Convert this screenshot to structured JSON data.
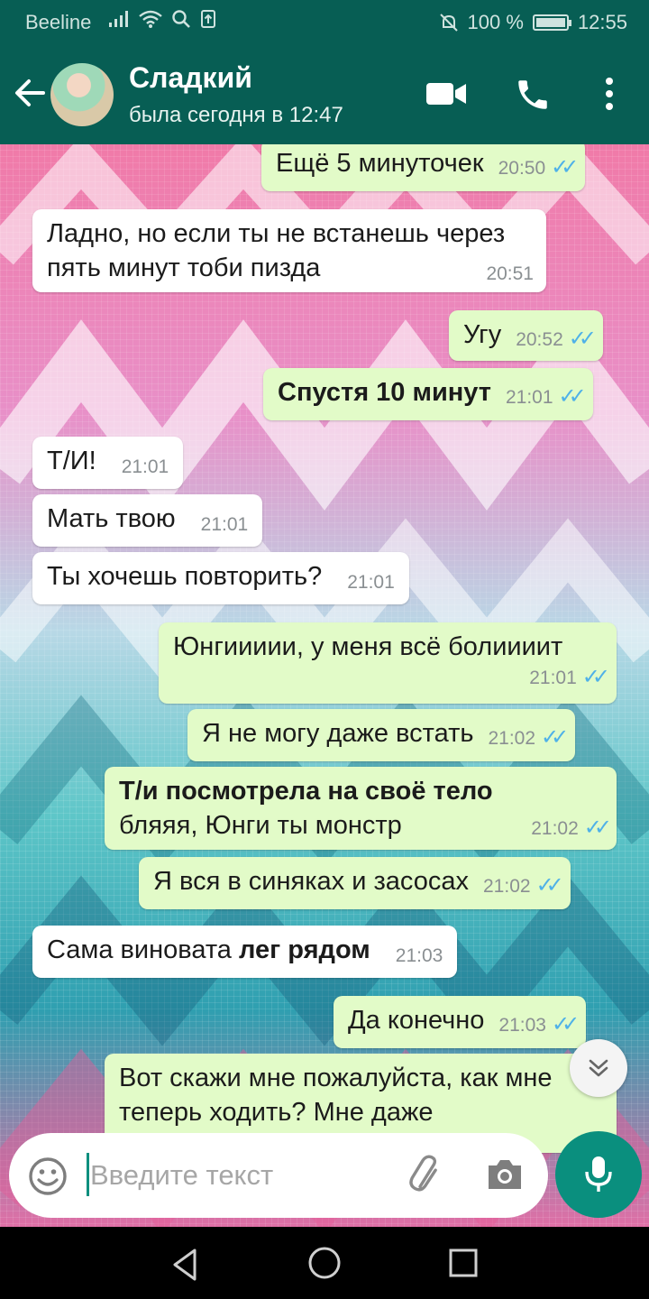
{
  "status_bar": {
    "carrier": "Beeline",
    "battery": "100 %",
    "battery_level": 1.0,
    "time": "12:55"
  },
  "header": {
    "contact_name": "Сладкий",
    "last_seen": "была сегодня в 12:47"
  },
  "messages": [
    {
      "dir": "out",
      "text": "Ещё 5 минуточек",
      "time": "20:50",
      "ticks": "✓✓"
    },
    {
      "dir": "in",
      "text": "Ладно, но если ты не встанешь через пять минут тоби пизда",
      "time": "20:51"
    },
    {
      "dir": "out",
      "text": "Угу",
      "time": "20:52",
      "ticks": "✓✓"
    },
    {
      "dir": "out",
      "text": "Спустя 10 минут",
      "time": "21:01",
      "ticks": "✓✓",
      "bold": true
    },
    {
      "dir": "in",
      "text": "Т/И!",
      "time": "21:01"
    },
    {
      "dir": "in",
      "text": "Мать твою",
      "time": "21:01"
    },
    {
      "dir": "in",
      "text": "Ты хочешь повторить?",
      "time": "21:01"
    },
    {
      "dir": "out",
      "text": "Юнгиииии, у меня всё болиииит",
      "time": "21:01",
      "ticks": "✓✓"
    },
    {
      "dir": "out",
      "text": "Я не могу даже встать",
      "time": "21:02",
      "ticks": "✓✓"
    },
    {
      "dir": "out",
      "text_bold": "Т/и посмотрела на своё тело",
      "text": "бляяя, Юнги ты монстр",
      "time": "21:02",
      "ticks": "✓✓"
    },
    {
      "dir": "out",
      "text": "Я вся в синяках и засосах",
      "time": "21:02",
      "ticks": "✓✓"
    },
    {
      "dir": "in",
      "text": "Сама виновата",
      "text_bold": "лег рядом",
      "time": "21:03"
    },
    {
      "dir": "out",
      "text": "Да конечно",
      "time": "21:03",
      "ticks": "✓✓"
    },
    {
      "dir": "out",
      "text": "Вот скажи мне пожалуйста, как мне теперь ходить? Мне даже"
    }
  ],
  "input": {
    "placeholder": "Введите текст"
  },
  "colors": {
    "header": "#075e54",
    "bubble_out": "#e2fbc8",
    "bubble_in": "#ffffff",
    "accent": "#0a8f7e",
    "ticks": "#4fb1e8"
  },
  "icons": [
    "back-arrow-icon",
    "video-call-icon",
    "phone-icon",
    "more-vert-icon",
    "emoji-icon",
    "attach-icon",
    "camera-icon",
    "mic-icon",
    "chevron-double-down-icon",
    "nav-back-icon",
    "nav-home-icon",
    "nav-recent-icon"
  ]
}
